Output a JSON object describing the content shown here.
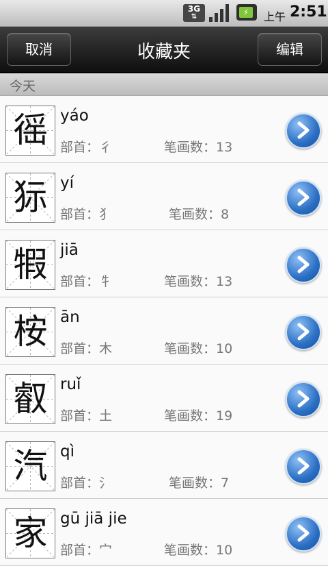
{
  "status_bar": {
    "network": "3G",
    "ampm": "上午",
    "time": "2:51"
  },
  "title_bar": {
    "cancel_label": "取消",
    "title": "收藏夹",
    "edit_label": "编辑"
  },
  "section": {
    "label": "今天"
  },
  "list": [
    {
      "character": "徭",
      "pinyin": "yáo",
      "radical": "部首：彳",
      "strokes": "笔画数：13"
    },
    {
      "character": "狋",
      "pinyin": "yí",
      "radical": "部首：犭",
      "strokes": "笔画数：8"
    },
    {
      "character": "犌",
      "pinyin": "jiā",
      "radical": "部首：牜",
      "strokes": "笔画数：13"
    },
    {
      "character": "桉",
      "pinyin": "ān",
      "radical": "部首：木",
      "strokes": "笔画数：10"
    },
    {
      "character": "叡",
      "pinyin": "ruǐ",
      "radical": "部首：土",
      "strokes": "笔画数：19"
    },
    {
      "character": "汽",
      "pinyin": "qì",
      "radical": "部首：氵",
      "strokes": "笔画数：7"
    },
    {
      "character": "家",
      "pinyin": "gū   jiā   jie",
      "radical": "部首：宀",
      "strokes": "笔画数：10"
    }
  ]
}
